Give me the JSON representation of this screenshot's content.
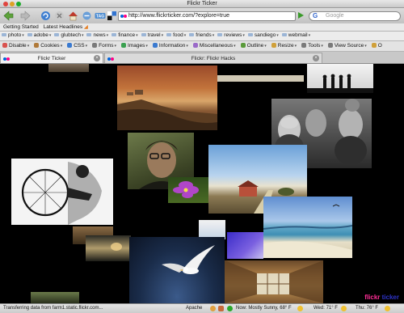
{
  "window": {
    "title": "Flickr Ticker"
  },
  "navigation": {
    "url": "http://www.flickrticker.com/?explore=true",
    "search_placeholder": "Google",
    "search_engine_icon": "google-icon"
  },
  "bookmarks_toolbar": {
    "items": [
      "Getting Started",
      "Latest Headlines"
    ]
  },
  "folders_toolbar": {
    "items": [
      "photo",
      "adobe",
      "glubtech",
      "news",
      "finance",
      "travel",
      "food",
      "friends",
      "reviews",
      "sandiego",
      "webmail"
    ]
  },
  "webdev_toolbar": {
    "items": [
      "Disable",
      "Cookies",
      "CSS",
      "Forms",
      "Images",
      "Information",
      "Miscellaneous",
      "Outline",
      "Resize",
      "Tools",
      "View Source",
      "O"
    ]
  },
  "tabs": [
    {
      "label": "Flickr Ticker",
      "active": true
    },
    {
      "label": "Flickr: Flickr Hacks",
      "active": false
    }
  ],
  "page": {
    "logo_first": "flickr",
    "logo_second": "ticker",
    "logo_colors": {
      "pink": "#ff2d96",
      "blue": "#2d33c8"
    }
  },
  "status_bar": {
    "message": "Transferring data from farm1.static.flickr.com...",
    "server": "Apache",
    "weather_now": "Now: Mostly Sunny, 68° F",
    "weather_wed": "Wed: 71° F",
    "weather_thu": "Thu: 76° F"
  }
}
